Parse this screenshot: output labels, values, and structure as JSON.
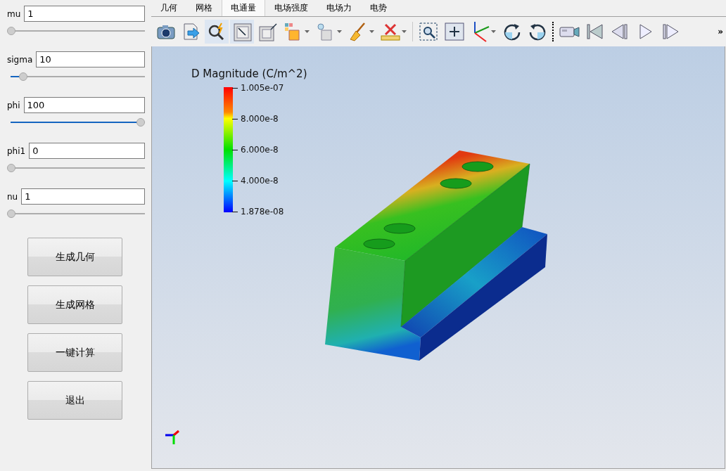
{
  "params": [
    {
      "label": "mu",
      "value": "1",
      "level": 0
    },
    {
      "label": "sigma",
      "value": "10",
      "level": 0.09
    },
    {
      "label": "phi",
      "value": "100",
      "level": 1
    },
    {
      "label": "phi1",
      "value": "0",
      "level": 0
    },
    {
      "label": "nu",
      "value": "1",
      "level": 0
    }
  ],
  "buttons": [
    "生成几何",
    "生成网格",
    "一键计算",
    "退出"
  ],
  "tabs": [
    {
      "label": "几何",
      "selected": false
    },
    {
      "label": "网格",
      "selected": false
    },
    {
      "label": "电通量",
      "selected": true
    },
    {
      "label": "电场强度",
      "selected": false
    },
    {
      "label": "电场力",
      "selected": false
    },
    {
      "label": "电势",
      "selected": false
    }
  ],
  "toolbar": [
    {
      "kind": "button",
      "pressed": false,
      "menu": false
    },
    {
      "kind": "button",
      "pressed": false,
      "menu": false
    },
    {
      "kind": "button",
      "pressed": true,
      "menu": false
    },
    {
      "kind": "button",
      "pressed": true,
      "menu": false
    },
    {
      "kind": "button",
      "pressed": false,
      "menu": false
    },
    {
      "kind": "button",
      "pressed": false,
      "menu": true
    },
    {
      "kind": "button",
      "pressed": false,
      "menu": true
    },
    {
      "kind": "button",
      "pressed": false,
      "menu": true
    },
    {
      "kind": "button",
      "pressed": false,
      "menu": true
    },
    {
      "kind": "separator"
    },
    {
      "kind": "button",
      "pressed": false,
      "menu": false
    },
    {
      "kind": "button",
      "pressed": false,
      "menu": false
    },
    {
      "kind": "button",
      "pressed": false,
      "menu": true
    },
    {
      "kind": "button",
      "pressed": false,
      "menu": false
    },
    {
      "kind": "button",
      "pressed": false,
      "menu": false
    },
    {
      "kind": "separator"
    },
    {
      "kind": "button",
      "pressed": false,
      "menu": false
    },
    {
      "kind": "button",
      "pressed": false,
      "menu": false
    },
    {
      "kind": "button",
      "pressed": false,
      "menu": false
    },
    {
      "kind": "button",
      "pressed": false,
      "menu": false
    },
    {
      "kind": "button",
      "pressed": false,
      "menu": false
    }
  ],
  "toolbar_overflow": "»",
  "legend": {
    "title": "D Magnitude (C/m^2)",
    "ticks": [
      "1.005e-07",
      "8.000e-8",
      "6.000e-8",
      "4.000e-8",
      "1.878e-08"
    ]
  }
}
